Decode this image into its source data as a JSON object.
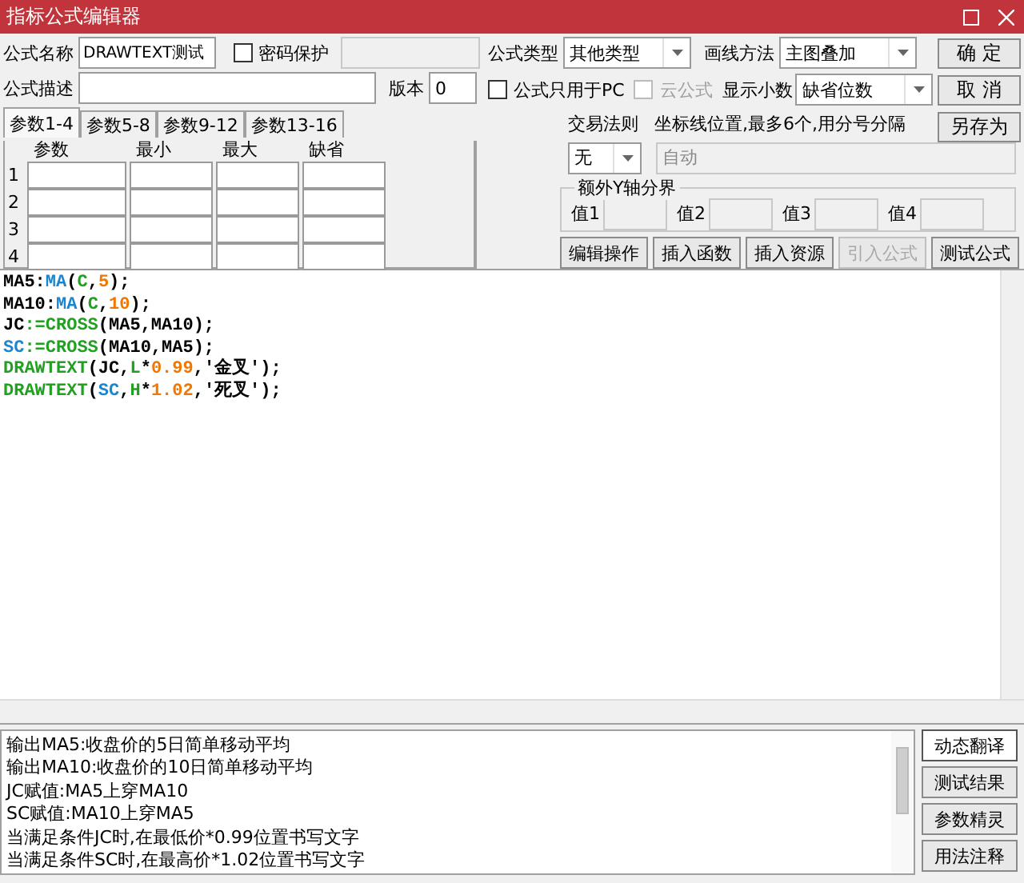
{
  "window": {
    "title": "指标公式编辑器"
  },
  "formula_name": {
    "label": "公式名称",
    "value": "DRAWTEXT测试"
  },
  "password_protect": {
    "label": "密码保护",
    "checked": false
  },
  "password_field": {
    "disabled": true
  },
  "description": {
    "label": "公式描述"
  },
  "version": {
    "label": "版本",
    "value": "0"
  },
  "param_tabs": [
    {
      "label": "参数1-4",
      "selected": true
    },
    {
      "label": "参数5-8",
      "selected": false
    },
    {
      "label": "参数9-12",
      "selected": false
    },
    {
      "label": "参数13-16",
      "selected": false
    }
  ],
  "param_table": {
    "columns": [
      "参数",
      "最小",
      "最大",
      "缺省"
    ],
    "rows": [
      "1",
      "2",
      "3",
      "4"
    ]
  },
  "formula_type": {
    "label": "公式类型",
    "value": "其他类型"
  },
  "draw_method": {
    "label": "画线方法",
    "value": "主图叠加"
  },
  "pc_only": {
    "label": "公式只用于PC",
    "checked": false,
    "disabled": false
  },
  "cloud_formula": {
    "label": "云公式",
    "checked": false,
    "disabled": true
  },
  "decimals": {
    "label": "显示小数",
    "value": "缺省位数"
  },
  "dialog_buttons": [
    {
      "label": "确 定"
    },
    {
      "label": "取 消"
    },
    {
      "label": "另存为"
    }
  ],
  "trade_rule": {
    "label": "交易法则",
    "value": "无"
  },
  "axis_lines": {
    "label": "坐标线位置,最多6个,用分号分隔",
    "placeholder": "自动",
    "disabled": true
  },
  "extra_y_axis": {
    "title": "额外Y轴分界",
    "fields": [
      {
        "label": "值1"
      },
      {
        "label": "值2"
      },
      {
        "label": "值3"
      },
      {
        "label": "值4"
      }
    ]
  },
  "tool_buttons": [
    {
      "label": "编辑操作",
      "disabled": false
    },
    {
      "label": "插入函数",
      "disabled": false
    },
    {
      "label": "插入资源",
      "disabled": false
    },
    {
      "label": "引入公式",
      "disabled": true
    },
    {
      "label": "测试公式",
      "disabled": false
    }
  ],
  "code": [
    [
      {
        "text": "MA5:",
        "kind": "plain"
      },
      {
        "text": "MA",
        "kind": "ident"
      },
      {
        "text": "(",
        "kind": "plain"
      },
      {
        "text": "C",
        "kind": "func"
      },
      {
        "text": ",",
        "kind": "plain"
      },
      {
        "text": "5",
        "kind": "num"
      },
      {
        "text": ");",
        "kind": "plain"
      }
    ],
    [
      {
        "text": "MA10:",
        "kind": "plain"
      },
      {
        "text": "MA",
        "kind": "ident"
      },
      {
        "text": "(",
        "kind": "plain"
      },
      {
        "text": "C",
        "kind": "func"
      },
      {
        "text": ",",
        "kind": "plain"
      },
      {
        "text": "10",
        "kind": "num"
      },
      {
        "text": ");",
        "kind": "plain"
      }
    ],
    [
      {
        "text": "JC",
        "kind": "plain"
      },
      {
        "text": ":=CROSS",
        "kind": "func"
      },
      {
        "text": "(MA5,MA10);",
        "kind": "plain"
      }
    ],
    [
      {
        "text": "SC",
        "kind": "ident"
      },
      {
        "text": ":=CROSS",
        "kind": "func"
      },
      {
        "text": "(MA10,MA5);",
        "kind": "plain"
      }
    ],
    [
      {
        "text": "DRAWTEXT",
        "kind": "func"
      },
      {
        "text": "(JC,",
        "kind": "plain"
      },
      {
        "text": "L",
        "kind": "func"
      },
      {
        "text": "*",
        "kind": "plain"
      },
      {
        "text": "0.99",
        "kind": "num"
      },
      {
        "text": ",'金叉');",
        "kind": "plain"
      }
    ],
    [
      {
        "text": "DRAWTEXT",
        "kind": "func"
      },
      {
        "text": "(",
        "kind": "plain"
      },
      {
        "text": "SC",
        "kind": "ident"
      },
      {
        "text": ",",
        "kind": "plain"
      },
      {
        "text": "H",
        "kind": "func"
      },
      {
        "text": "*",
        "kind": "plain"
      },
      {
        "text": "1.02",
        "kind": "num"
      },
      {
        "text": ",'死叉');",
        "kind": "plain"
      }
    ]
  ],
  "output_lines": [
    "输出MA5:收盘价的5日简单移动平均",
    "输出MA10:收盘价的10日简单移动平均",
    "JC赋值:MA5上穿MA10",
    "SC赋值:MA10上穿MA5",
    "当满足条件JC时,在最低价*0.99位置书写文字",
    "当满足条件SC时,在最高价*1.02位置书写文字"
  ],
  "side_buttons": [
    {
      "label": "动态翻译",
      "selected": true
    },
    {
      "label": "测试结果",
      "selected": false
    },
    {
      "label": "参数精灵",
      "selected": false
    },
    {
      "label": "用法注释",
      "selected": false
    }
  ]
}
